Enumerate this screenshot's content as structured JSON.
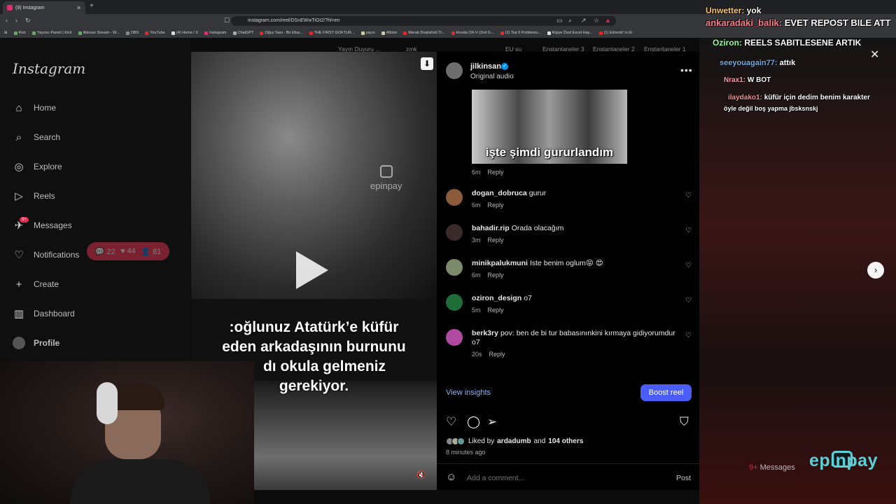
{
  "browser": {
    "tab_title": "(9) Instagram",
    "new_tab": "+",
    "url": "instagram.com/reel/DSnEWwTiGt2/?hl=en",
    "bookmarks": [
      "Kick",
      "Yayıncı Paneli | Kick",
      "ilkinsan Stream - W...",
      "OBS",
      "YouTube",
      "(4) Home / X",
      "Instagram",
      "ChatGPT",
      "Oğuz Sasi - Bir Efsa...",
      "THE FIRST GOKTUR...",
      "yayın",
      "Albüm",
      "Merab Dvalishvili Tr...",
      "Honda CR-V (2nd G...",
      "(1) Top 5 Problems...",
      "Kişiye Özel Excel Hay...",
      "(1) Edremit' in El"
    ]
  },
  "top_labels": [
    "Yayın Duyuru ...",
    "zınk",
    "EU su",
    "Enstantaneler 3",
    "Enstantaneler 2",
    "Enstantaneler 1"
  ],
  "sidebar": {
    "logo": "Instagram",
    "items": [
      {
        "label": "Home",
        "icon": "home-icon",
        "glyph": "⌂"
      },
      {
        "label": "Search",
        "icon": "search-icon",
        "glyph": "⌕"
      },
      {
        "label": "Explore",
        "icon": "compass-icon",
        "glyph": "◎"
      },
      {
        "label": "Reels",
        "icon": "reels-icon",
        "glyph": "▷"
      },
      {
        "label": "Messages",
        "icon": "messenger-icon",
        "glyph": "✈"
      },
      {
        "label": "Notifications",
        "icon": "heart-icon",
        "glyph": "♡"
      },
      {
        "label": "Create",
        "icon": "plus-icon",
        "glyph": "+"
      },
      {
        "label": "Dashboard",
        "icon": "chart-icon",
        "glyph": "▥"
      },
      {
        "label": "Profile",
        "icon": "avatar-icon",
        "glyph": "●"
      }
    ],
    "messages_badge": "9+",
    "notif_pill": {
      "comments": "22",
      "likes": "44",
      "follows": "81"
    }
  },
  "reel": {
    "watermark": "epinpay",
    "caption_lines": [
      ":oğlunuz Atatürk’e küfür",
      "eden arkadaşının burnunu",
      "dı okula gelmeniz",
      "gerekiyor."
    ]
  },
  "post": {
    "author": "jilkinsan",
    "audio": "Original audio",
    "meme_text": "işte şimdi gururlandım",
    "meme_time": "6m",
    "reply_label": "Reply",
    "comments": [
      {
        "user": "dogan_dobruca",
        "text": "gurur",
        "time": "6m",
        "color": "#8a5a3a"
      },
      {
        "user": "bahadir.rip",
        "text": "Orada olacağım",
        "time": "3m",
        "color": "#3a2a2a"
      },
      {
        "user": "minikpalukmuni",
        "text": "Iste benim oglum😝 😍",
        "time": "6m",
        "color": "#7a8a6a"
      },
      {
        "user": "oziron_design",
        "text": "o7",
        "time": "5m",
        "color": "#1f6e3a"
      },
      {
        "user": "berk3ry",
        "text": "pov: ben de bi tur babasınınkini kırmaya gidiyorumdur o7",
        "time": "20s",
        "color": "#b04aa0"
      }
    ],
    "view_insights": "View insights",
    "boost": "Boost reel",
    "liked_by_user": "ardadumb",
    "liked_by_others": "104 others",
    "liked_prefix": "Liked by",
    "liked_and": "and",
    "time_ago": "8 minutes ago",
    "comment_placeholder": "Add a comment...",
    "post_label": "Post"
  },
  "chat_overlay": [
    {
      "user": "Unwetter:",
      "msg": "yok"
    },
    {
      "user": "ankaradaki_balik:",
      "msg": "EVET REPOST BILE ATT"
    },
    {
      "user": "Oziron:",
      "msg": "REELS SABITLESENE ARTIK"
    },
    {
      "user": "seeyouagain77:",
      "msg": "attık"
    },
    {
      "user": "Nrax1:",
      "msg": "W BOT"
    },
    {
      "user": "ilaydako1:",
      "msg": "küfür için dedim benim karakter"
    },
    {
      "user": "",
      "msg": "öyle değil boş yapma jbsksnskj"
    }
  ],
  "brand": {
    "name": "epinpay",
    "messages": "Messages",
    "badge": "9+"
  },
  "colors": {
    "accent": "#4a5df9",
    "badge": "#e2264d",
    "brand": "#5bd0d8",
    "link": "#8bb4ff"
  }
}
